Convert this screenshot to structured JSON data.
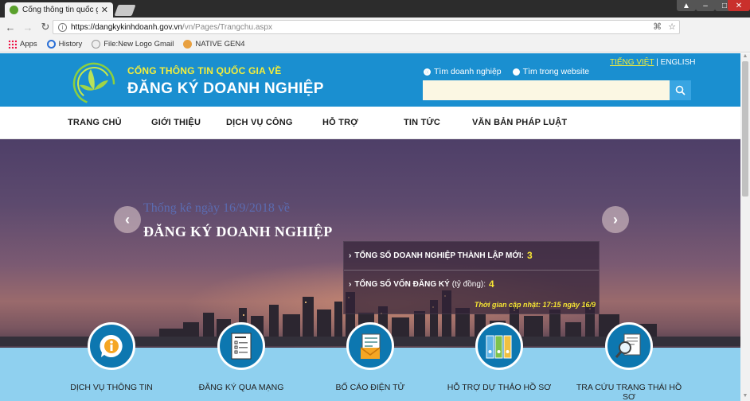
{
  "browser": {
    "tab_title": "Cổng thông tin quốc gia",
    "url_host": "https://dangkykinhdoanh.gov.vn",
    "url_path": "/vn/Pages/Trangchu.aspx",
    "bookmarks": [
      {
        "label": "Apps",
        "icon": "apps-grid-icon"
      },
      {
        "label": "History",
        "icon": "history-icon"
      },
      {
        "label": "File:New Logo Gmail",
        "icon": "wiki-icon"
      },
      {
        "label": "NATIVE GEN4",
        "icon": "native-icon"
      }
    ]
  },
  "header": {
    "subtitle": "CỔNG THÔNG TIN QUỐC GIA VỀ",
    "title": "ĐĂNG KÝ DOANH NGHIỆP",
    "lang_vi": "TIẾNG VIỆT",
    "lang_sep": "|",
    "lang_en": "ENGLISH",
    "search_options": [
      {
        "label": "Tìm doanh nghiệp",
        "selected": true
      },
      {
        "label": "Tìm trong website",
        "selected": false
      }
    ],
    "search_value": ""
  },
  "nav": {
    "items": [
      "TRANG CHỦ",
      "GIỚI THIỆU",
      "DỊCH VỤ CÔNG",
      "HỖ TRỢ",
      "TIN TỨC",
      "VĂN BẢN PHÁP LUẬT"
    ]
  },
  "hero": {
    "line1": "Thống kê ngày 16/9/2018 về",
    "line2": "ĐĂNG KÝ DOANH NGHIỆP",
    "stat1_label": "TỔNG SỐ DOANH NGHIỆP THÀNH LẬP MỚI:",
    "stat1_value": "3",
    "stat2_label": "TỔNG SỐ VỐN ĐĂNG KÝ",
    "stat2_unit": "(tỷ đồng):",
    "stat2_value": "4",
    "updated": "Thời gian cập nhật: 17:15 ngày 16/9"
  },
  "services": [
    {
      "label": "DỊCH VỤ THÔNG TIN",
      "icon": "info-icon"
    },
    {
      "label": "ĐĂNG KÝ QUA MẠNG",
      "icon": "registration-form-icon"
    },
    {
      "label": "BỐ CÁO ĐIỆN TỬ",
      "icon": "announcement-envelope-icon"
    },
    {
      "label": "HỖ TRỢ DỰ THẢO HỒ SƠ",
      "icon": "binders-icon"
    },
    {
      "label": "TRA CỨU TRẠNG THÁI HỒ SƠ",
      "icon": "document-search-icon"
    }
  ],
  "colors": {
    "header_blue": "#1a8fd0",
    "accent_yellow": "#f4ee3a",
    "service_band": "#8fd0ef",
    "service_circle": "#0d77b0"
  }
}
